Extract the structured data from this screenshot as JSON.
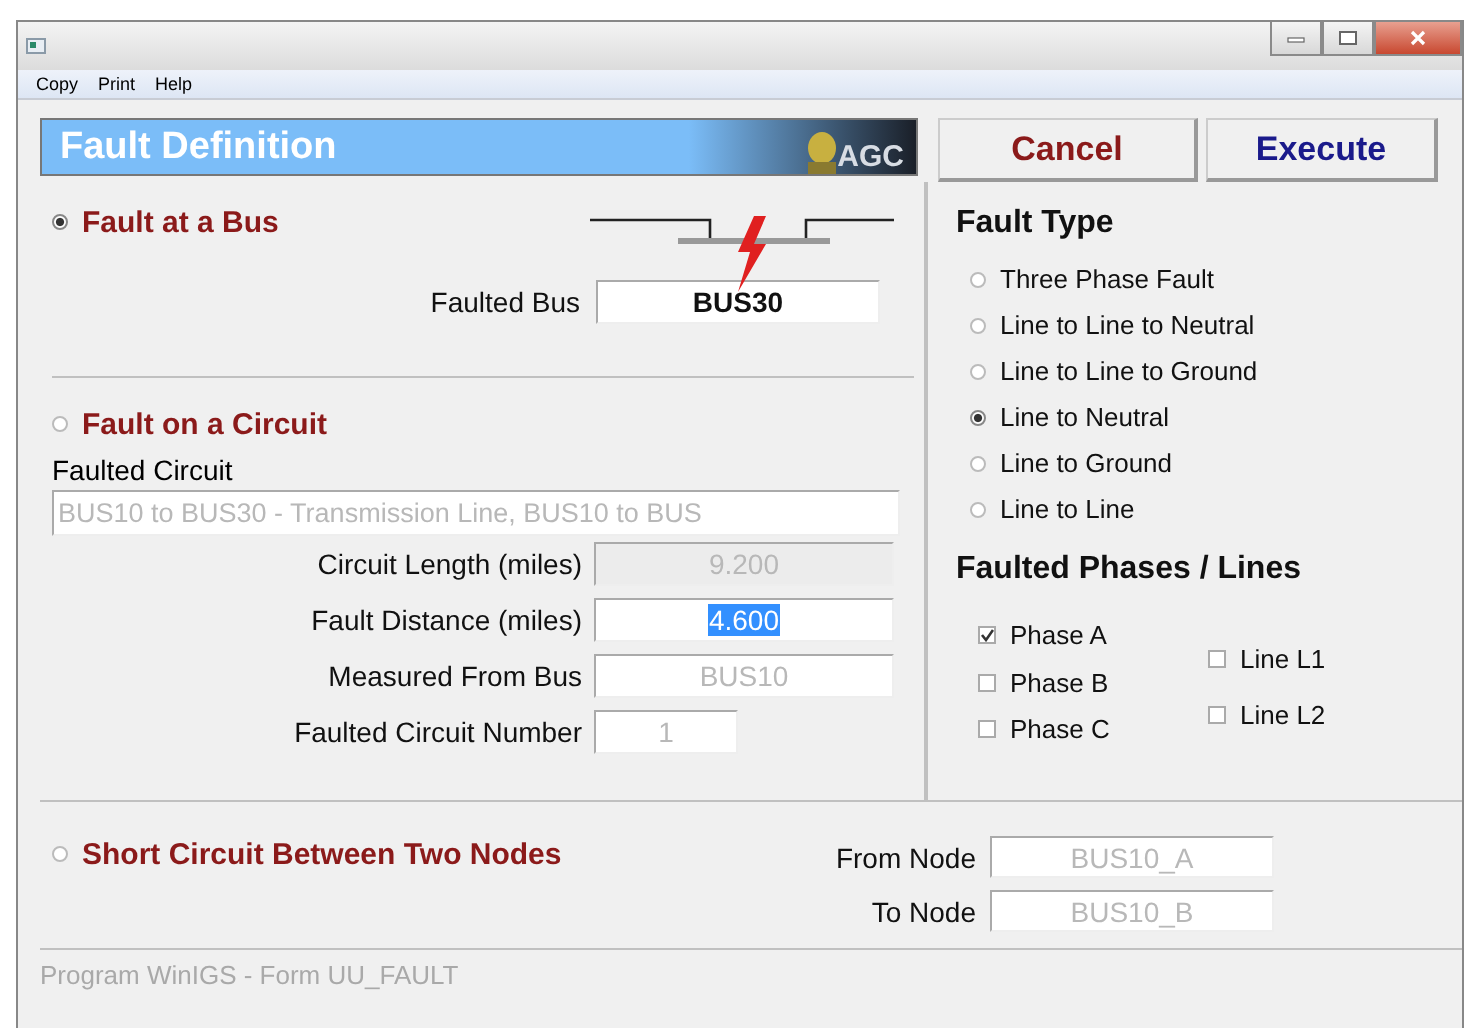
{
  "menu": [
    "Copy",
    "Print",
    "Help"
  ],
  "header": {
    "title": "Fault Definition",
    "logo_text": "AGC"
  },
  "buttons": [
    {
      "label": "Cancel",
      "kind": "cancel"
    },
    {
      "label": "Execute",
      "kind": "execute"
    }
  ],
  "fault_at_bus": {
    "label": "Fault at a Bus",
    "selected": true,
    "faulted_bus_label": "Faulted Bus",
    "faulted_bus": "BUS30"
  },
  "fault_on_circuit": {
    "label": "Fault on a Circuit",
    "selected": false,
    "faulted_circuit_label": "Faulted Circuit",
    "faulted_circuit": "BUS10 to BUS30 - Transmission Line, BUS10 to BUS",
    "fields": [
      {
        "label": "Circuit Length (miles)",
        "value": "9.200",
        "disabled": true,
        "read_only": true,
        "highlighted": false,
        "kind": "wide"
      },
      {
        "label": "Fault Distance (miles)",
        "value": "4.600",
        "disabled": false,
        "read_only": false,
        "highlighted": true,
        "kind": "wide"
      },
      {
        "label": "Measured From Bus",
        "value": "BUS10",
        "disabled": true,
        "read_only": false,
        "highlighted": false,
        "kind": "wide"
      },
      {
        "label": "Faulted Circuit Number",
        "value": "1",
        "disabled": true,
        "read_only": false,
        "highlighted": false,
        "kind": "narrow"
      }
    ]
  },
  "fault_type": {
    "title": "Fault Type",
    "options": [
      {
        "label": "Three Phase Fault",
        "selected": false
      },
      {
        "label": "Line to Line to Neutral",
        "selected": false
      },
      {
        "label": "Line to Line to Ground",
        "selected": false
      },
      {
        "label": "Line to Neutral",
        "selected": true
      },
      {
        "label": "Line to Ground",
        "selected": false
      },
      {
        "label": "Line to Line",
        "selected": false
      }
    ]
  },
  "faulted_phases": {
    "title": "Faulted Phases / Lines",
    "columns": [
      [
        {
          "label": "Phase A",
          "checked": true
        },
        {
          "label": "Phase B",
          "checked": false
        },
        {
          "label": "Phase C",
          "checked": false
        }
      ],
      [
        {
          "label": "Line L1",
          "checked": false
        },
        {
          "label": "Line L2",
          "checked": false
        }
      ]
    ]
  },
  "short_circuit": {
    "label": "Short Circuit Between Two Nodes",
    "selected": false,
    "nodes": [
      {
        "label": "From Node",
        "value": "BUS10_A",
        "disabled": true
      },
      {
        "label": "To Node",
        "value": "BUS10_B",
        "disabled": true
      }
    ]
  },
  "status_bar": "Program WinIGS - Form UU_FAULT"
}
